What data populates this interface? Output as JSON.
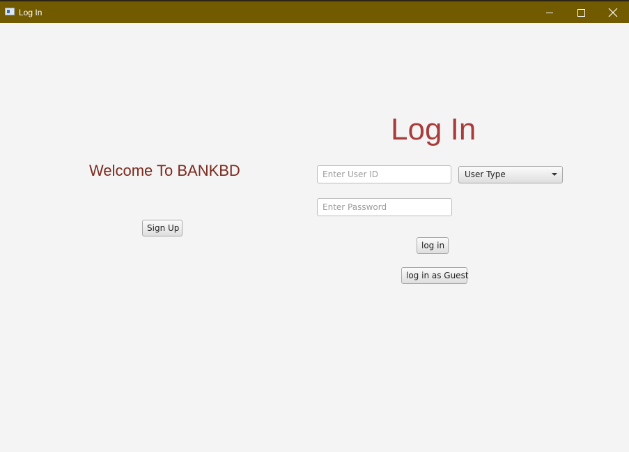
{
  "window": {
    "title": "Log In"
  },
  "left_panel": {
    "welcome_text": "Welcome To BANKBD",
    "signup_label": "Sign Up"
  },
  "login_form": {
    "heading": "Log In",
    "user_id": {
      "value": "",
      "placeholder": "Enter User ID"
    },
    "password": {
      "value": "",
      "placeholder": "Enter Password"
    },
    "user_type": {
      "selected": "User Type"
    },
    "login_label": "log in",
    "guest_label": "log in as Guest"
  },
  "colors": {
    "titlebar": "#725a00",
    "welcome_text": "#7a2a1e",
    "heading": "#a83c3c",
    "background": "#f4f4f4"
  }
}
